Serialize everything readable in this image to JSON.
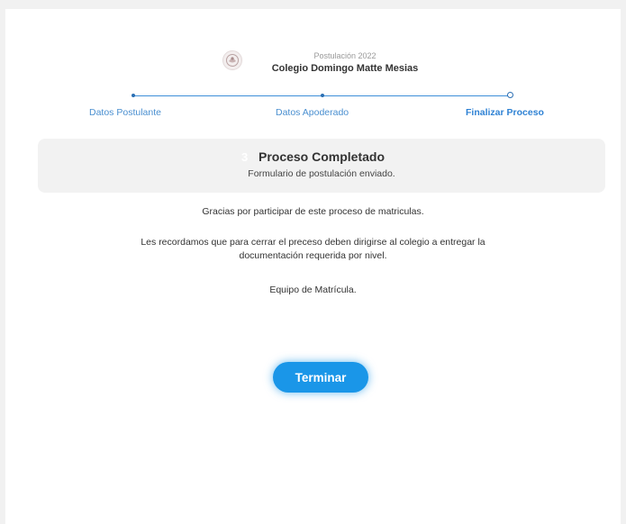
{
  "header": {
    "subtitle": "Postulación 2022",
    "title": "Colegio Domingo Matte Mesias"
  },
  "stepper": {
    "steps": [
      {
        "label": "Datos Postulante",
        "state": "done"
      },
      {
        "label": "Datos Apoderado",
        "state": "done"
      },
      {
        "label": "Finalizar Proceso",
        "state": "active"
      }
    ]
  },
  "status": {
    "step_number": "3",
    "title": "Proceso Completado",
    "subtitle": "Formulario de postulación enviado."
  },
  "messages": {
    "thanks": "Gracias por participar de este proceso de matriculas.",
    "reminder_line1": "Les recordamos que para cerrar el preceso deben dirigirse al colegio a entregar la",
    "reminder_line2": "documentación requerida por nivel.",
    "signature": "Equipo de Matrícula."
  },
  "actions": {
    "finish_label": "Terminar"
  },
  "colors": {
    "accent": "#1a96e8",
    "step_line": "#3d8fd9",
    "step_label": "#4a8fd0"
  }
}
